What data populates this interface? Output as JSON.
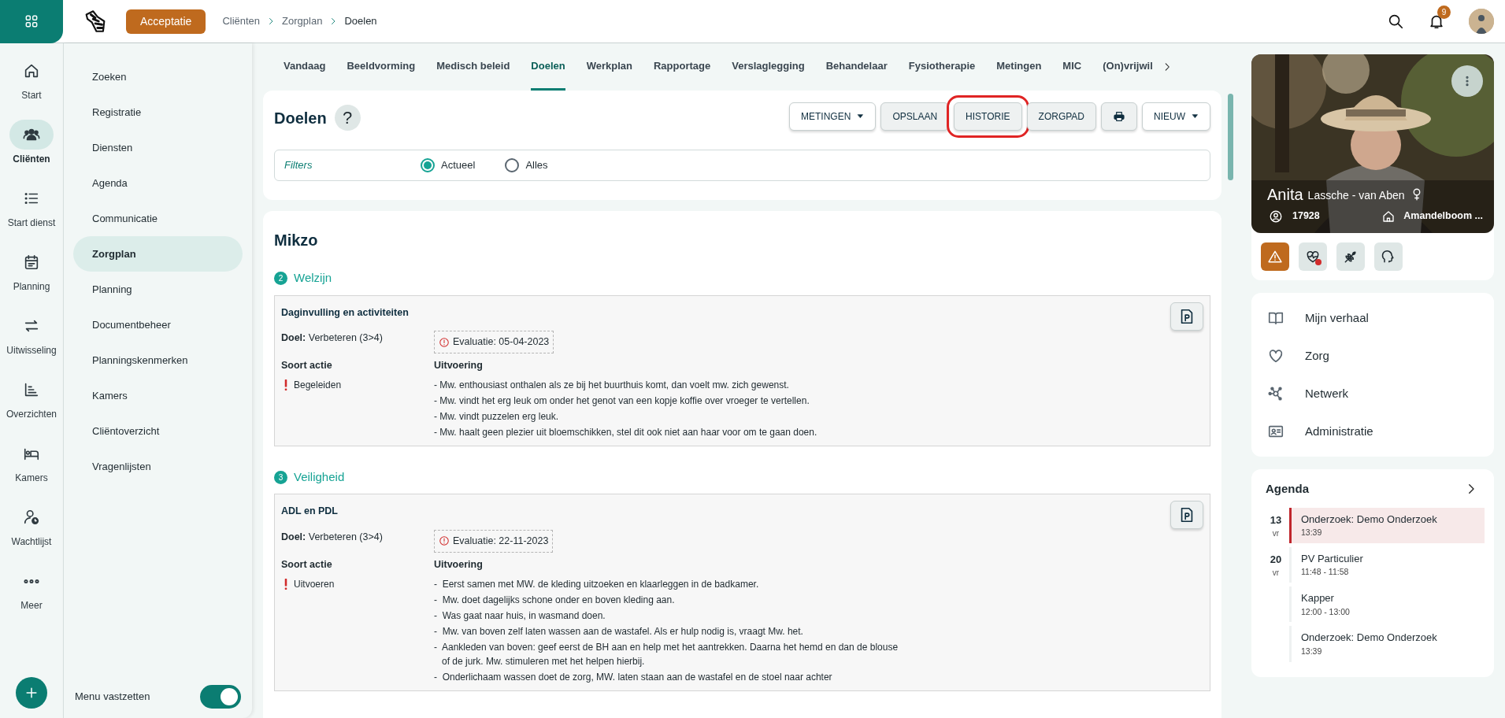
{
  "topbar": {
    "environment": "Acceptatie",
    "breadcrumb": [
      {
        "label": "Cliënten",
        "current": false
      },
      {
        "label": "Zorgplan",
        "current": false
      },
      {
        "label": "Doelen",
        "current": true
      }
    ],
    "notifications": "9"
  },
  "rail": [
    {
      "label": "Start",
      "selected": false
    },
    {
      "label": "Cliënten",
      "selected": true
    },
    {
      "label": "Start dienst",
      "selected": false
    },
    {
      "label": "Planning",
      "selected": false
    },
    {
      "label": "Uitwisseling",
      "selected": false
    },
    {
      "label": "Overzichten",
      "selected": false
    },
    {
      "label": "Kamers",
      "selected": false
    },
    {
      "label": "Wachtlijst",
      "selected": false
    },
    {
      "label": "Meer",
      "selected": false
    }
  ],
  "submenu": {
    "items": [
      {
        "label": "Zoeken",
        "selected": false
      },
      {
        "label": "Registratie",
        "selected": false
      },
      {
        "label": "Diensten",
        "selected": false
      },
      {
        "label": "Agenda",
        "selected": false
      },
      {
        "label": "Communicatie",
        "selected": false
      },
      {
        "label": "Zorgplan",
        "selected": true
      },
      {
        "label": "Planning",
        "selected": false
      },
      {
        "label": "Documentbeheer",
        "selected": false
      },
      {
        "label": "Planningskenmerken",
        "selected": false
      },
      {
        "label": "Kamers",
        "selected": false
      },
      {
        "label": "Cliëntoverzicht",
        "selected": false
      },
      {
        "label": "Vragenlijsten",
        "selected": false
      }
    ],
    "pin": {
      "label": "Menu vastzetten",
      "on": true
    }
  },
  "tabs": [
    {
      "label": "Vandaag",
      "selected": false
    },
    {
      "label": "Beeldvorming",
      "selected": false
    },
    {
      "label": "Medisch beleid",
      "selected": false
    },
    {
      "label": "Doelen",
      "selected": true
    },
    {
      "label": "Werkplan",
      "selected": false
    },
    {
      "label": "Rapportage",
      "selected": false
    },
    {
      "label": "Verslaglegging",
      "selected": false
    },
    {
      "label": "Behandelaar",
      "selected": false
    },
    {
      "label": "Fysiotherapie",
      "selected": false
    },
    {
      "label": "Metingen",
      "selected": false
    },
    {
      "label": "MIC",
      "selected": false
    },
    {
      "label": "(On)vrijwil",
      "selected": false
    }
  ],
  "panel": {
    "title": "Doelen",
    "help": "?",
    "buttons": [
      {
        "kind": "dropdown",
        "label": "METINGEN",
        "highlighted": false
      },
      {
        "kind": "plain",
        "label": "OPSLAAN",
        "highlighted": false
      },
      {
        "kind": "plain",
        "label": "HISTORIE",
        "highlighted": true
      },
      {
        "kind": "plain",
        "label": "ZORGPAD",
        "highlighted": false
      },
      {
        "kind": "print",
        "highlighted": false
      },
      {
        "kind": "dropdown",
        "label": "NIEUW",
        "highlighted": false
      }
    ],
    "filters": {
      "label": "Filters",
      "options": [
        {
          "label": "Actueel",
          "selected": true
        },
        {
          "label": "Alles",
          "selected": false
        }
      ]
    }
  },
  "section": {
    "title": "Mikzo",
    "groups": [
      {
        "number": "2",
        "title": "Welzijn",
        "cards": [
          {
            "title": "Daginvulling en activiteiten",
            "goal_label": "Doel:",
            "goal": "Verbeteren (3>4)",
            "evaluation": "Evaluatie: 05-04-2023",
            "action_header": "Soort actie",
            "execution_header": "Uitvoering",
            "action": "Begeleiden",
            "lines": [
              "- Mw. enthousiast onthalen als ze bij het buurthuis komt, dan voelt mw. zich gewenst.",
              "- Mw. vindt het erg leuk om onder het genot van een kopje koffie over vroeger te vertellen.",
              "- Mw. vindt puzzelen erg leuk.",
              "- Mw. haalt geen plezier uit bloemschikken, stel dit ook niet aan haar voor om te gaan doen."
            ]
          }
        ]
      },
      {
        "number": "3",
        "title": "Veiligheid",
        "cards": [
          {
            "title": "ADL en PDL",
            "goal_label": "Doel:",
            "goal": "Verbeteren (3>4)",
            "evaluation": "Evaluatie: 22-11-2023",
            "action_header": "Soort actie",
            "execution_header": "Uitvoering",
            "action": "Uitvoeren",
            "lines": [
              "-  Eerst samen met MW. de kleding uitzoeken en klaarleggen in de badkamer.",
              "-  Mw. doet dagelijks schone onder en boven kleding aan.",
              "-  Was gaat naar huis, in wasmand doen.",
              "-  Mw. van boven zelf laten wassen aan de wastafel. Als er hulp nodig is, vraagt Mw. het.",
              "-  Aankleden van boven: geef eerst de BH aan en help met het aantrekken. Daarna het hemd en dan de blouse of de jurk. Mw. stimuleren met het helpen hierbij.",
              "-  Onderlichaam wassen doet de zorg, MW. laten staan aan de wastafel en de stoel naar achter"
            ]
          }
        ]
      }
    ]
  },
  "client": {
    "first_name": "Anita",
    "last_name": "Lassche - van Aben",
    "number": "17928",
    "location": "Amandelboom ...",
    "alerts": [
      {
        "kind": "warning",
        "active": true
      },
      {
        "kind": "heart",
        "active": false
      },
      {
        "kind": "grain",
        "active": false
      },
      {
        "kind": "head",
        "active": false
      }
    ]
  },
  "client_menu": [
    {
      "kind": "story",
      "label": "Mijn verhaal"
    },
    {
      "kind": "care",
      "label": "Zorg"
    },
    {
      "kind": "network",
      "label": "Netwerk"
    },
    {
      "kind": "admin",
      "label": "Administratie"
    }
  ],
  "agenda": {
    "title": "Agenda",
    "days": [
      {
        "day": "13",
        "weekday": "vr",
        "entries": [
          {
            "title": "Onderzoek: Demo Onderzoek",
            "time": "13:39",
            "selected": true
          }
        ]
      },
      {
        "day": "20",
        "weekday": "vr",
        "entries": [
          {
            "title": "PV Particulier",
            "time": "11:48 - 11:58",
            "selected": false
          },
          {
            "title": "Kapper",
            "time": "12:00 - 13:00",
            "selected": false
          },
          {
            "title": "Onderzoek: Demo Onderzoek",
            "time": "13:39",
            "selected": false
          }
        ]
      }
    ]
  }
}
